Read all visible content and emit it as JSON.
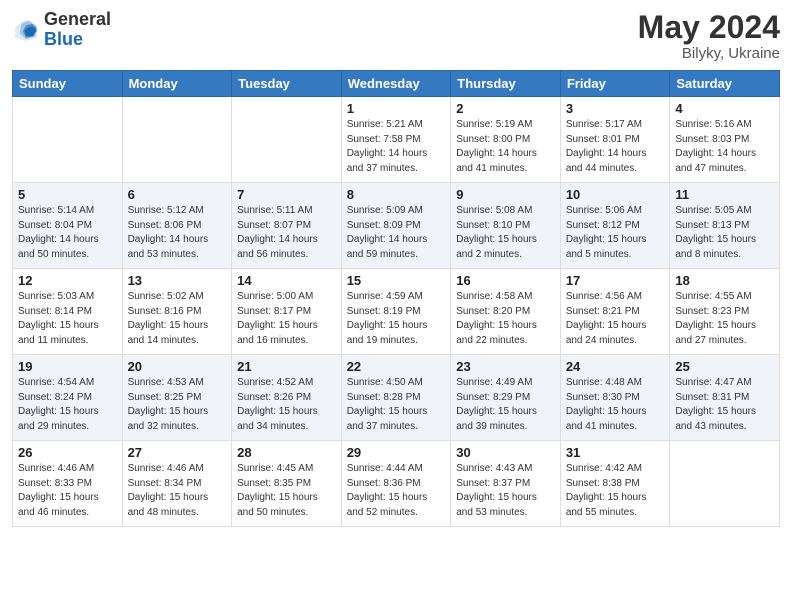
{
  "header": {
    "logo_general": "General",
    "logo_blue": "Blue",
    "month_title": "May 2024",
    "subtitle": "Bilyky, Ukraine"
  },
  "weekdays": [
    "Sunday",
    "Monday",
    "Tuesday",
    "Wednesday",
    "Thursday",
    "Friday",
    "Saturday"
  ],
  "rows": [
    [
      {
        "day": "",
        "sunrise": "",
        "sunset": "",
        "daylight": ""
      },
      {
        "day": "",
        "sunrise": "",
        "sunset": "",
        "daylight": ""
      },
      {
        "day": "",
        "sunrise": "",
        "sunset": "",
        "daylight": ""
      },
      {
        "day": "1",
        "sunrise": "Sunrise: 5:21 AM",
        "sunset": "Sunset: 7:58 PM",
        "daylight": "Daylight: 14 hours and 37 minutes."
      },
      {
        "day": "2",
        "sunrise": "Sunrise: 5:19 AM",
        "sunset": "Sunset: 8:00 PM",
        "daylight": "Daylight: 14 hours and 41 minutes."
      },
      {
        "day": "3",
        "sunrise": "Sunrise: 5:17 AM",
        "sunset": "Sunset: 8:01 PM",
        "daylight": "Daylight: 14 hours and 44 minutes."
      },
      {
        "day": "4",
        "sunrise": "Sunrise: 5:16 AM",
        "sunset": "Sunset: 8:03 PM",
        "daylight": "Daylight: 14 hours and 47 minutes."
      }
    ],
    [
      {
        "day": "5",
        "sunrise": "Sunrise: 5:14 AM",
        "sunset": "Sunset: 8:04 PM",
        "daylight": "Daylight: 14 hours and 50 minutes."
      },
      {
        "day": "6",
        "sunrise": "Sunrise: 5:12 AM",
        "sunset": "Sunset: 8:06 PM",
        "daylight": "Daylight: 14 hours and 53 minutes."
      },
      {
        "day": "7",
        "sunrise": "Sunrise: 5:11 AM",
        "sunset": "Sunset: 8:07 PM",
        "daylight": "Daylight: 14 hours and 56 minutes."
      },
      {
        "day": "8",
        "sunrise": "Sunrise: 5:09 AM",
        "sunset": "Sunset: 8:09 PM",
        "daylight": "Daylight: 14 hours and 59 minutes."
      },
      {
        "day": "9",
        "sunrise": "Sunrise: 5:08 AM",
        "sunset": "Sunset: 8:10 PM",
        "daylight": "Daylight: 15 hours and 2 minutes."
      },
      {
        "day": "10",
        "sunrise": "Sunrise: 5:06 AM",
        "sunset": "Sunset: 8:12 PM",
        "daylight": "Daylight: 15 hours and 5 minutes."
      },
      {
        "day": "11",
        "sunrise": "Sunrise: 5:05 AM",
        "sunset": "Sunset: 8:13 PM",
        "daylight": "Daylight: 15 hours and 8 minutes."
      }
    ],
    [
      {
        "day": "12",
        "sunrise": "Sunrise: 5:03 AM",
        "sunset": "Sunset: 8:14 PM",
        "daylight": "Daylight: 15 hours and 11 minutes."
      },
      {
        "day": "13",
        "sunrise": "Sunrise: 5:02 AM",
        "sunset": "Sunset: 8:16 PM",
        "daylight": "Daylight: 15 hours and 14 minutes."
      },
      {
        "day": "14",
        "sunrise": "Sunrise: 5:00 AM",
        "sunset": "Sunset: 8:17 PM",
        "daylight": "Daylight: 15 hours and 16 minutes."
      },
      {
        "day": "15",
        "sunrise": "Sunrise: 4:59 AM",
        "sunset": "Sunset: 8:19 PM",
        "daylight": "Daylight: 15 hours and 19 minutes."
      },
      {
        "day": "16",
        "sunrise": "Sunrise: 4:58 AM",
        "sunset": "Sunset: 8:20 PM",
        "daylight": "Daylight: 15 hours and 22 minutes."
      },
      {
        "day": "17",
        "sunrise": "Sunrise: 4:56 AM",
        "sunset": "Sunset: 8:21 PM",
        "daylight": "Daylight: 15 hours and 24 minutes."
      },
      {
        "day": "18",
        "sunrise": "Sunrise: 4:55 AM",
        "sunset": "Sunset: 8:23 PM",
        "daylight": "Daylight: 15 hours and 27 minutes."
      }
    ],
    [
      {
        "day": "19",
        "sunrise": "Sunrise: 4:54 AM",
        "sunset": "Sunset: 8:24 PM",
        "daylight": "Daylight: 15 hours and 29 minutes."
      },
      {
        "day": "20",
        "sunrise": "Sunrise: 4:53 AM",
        "sunset": "Sunset: 8:25 PM",
        "daylight": "Daylight: 15 hours and 32 minutes."
      },
      {
        "day": "21",
        "sunrise": "Sunrise: 4:52 AM",
        "sunset": "Sunset: 8:26 PM",
        "daylight": "Daylight: 15 hours and 34 minutes."
      },
      {
        "day": "22",
        "sunrise": "Sunrise: 4:50 AM",
        "sunset": "Sunset: 8:28 PM",
        "daylight": "Daylight: 15 hours and 37 minutes."
      },
      {
        "day": "23",
        "sunrise": "Sunrise: 4:49 AM",
        "sunset": "Sunset: 8:29 PM",
        "daylight": "Daylight: 15 hours and 39 minutes."
      },
      {
        "day": "24",
        "sunrise": "Sunrise: 4:48 AM",
        "sunset": "Sunset: 8:30 PM",
        "daylight": "Daylight: 15 hours and 41 minutes."
      },
      {
        "day": "25",
        "sunrise": "Sunrise: 4:47 AM",
        "sunset": "Sunset: 8:31 PM",
        "daylight": "Daylight: 15 hours and 43 minutes."
      }
    ],
    [
      {
        "day": "26",
        "sunrise": "Sunrise: 4:46 AM",
        "sunset": "Sunset: 8:33 PM",
        "daylight": "Daylight: 15 hours and 46 minutes."
      },
      {
        "day": "27",
        "sunrise": "Sunrise: 4:46 AM",
        "sunset": "Sunset: 8:34 PM",
        "daylight": "Daylight: 15 hours and 48 minutes."
      },
      {
        "day": "28",
        "sunrise": "Sunrise: 4:45 AM",
        "sunset": "Sunset: 8:35 PM",
        "daylight": "Daylight: 15 hours and 50 minutes."
      },
      {
        "day": "29",
        "sunrise": "Sunrise: 4:44 AM",
        "sunset": "Sunset: 8:36 PM",
        "daylight": "Daylight: 15 hours and 52 minutes."
      },
      {
        "day": "30",
        "sunrise": "Sunrise: 4:43 AM",
        "sunset": "Sunset: 8:37 PM",
        "daylight": "Daylight: 15 hours and 53 minutes."
      },
      {
        "day": "31",
        "sunrise": "Sunrise: 4:42 AM",
        "sunset": "Sunset: 8:38 PM",
        "daylight": "Daylight: 15 hours and 55 minutes."
      },
      {
        "day": "",
        "sunrise": "",
        "sunset": "",
        "daylight": ""
      }
    ]
  ]
}
